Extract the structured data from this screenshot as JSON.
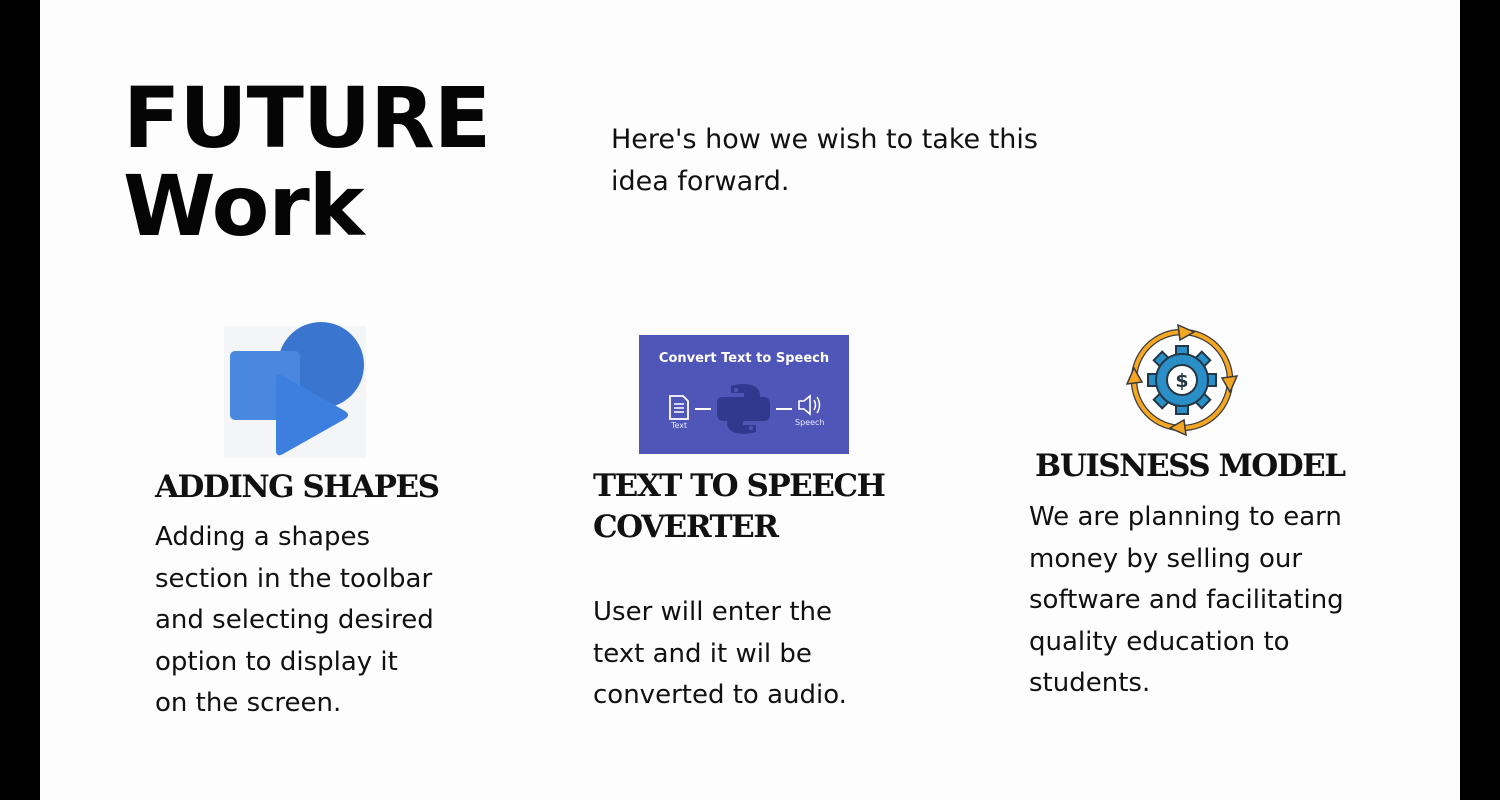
{
  "title": {
    "line1": "FUTURE",
    "line2": "Work"
  },
  "subtitle": {
    "line1": "Here's how we wish to take this",
    "line2": "idea forward."
  },
  "cards": [
    {
      "heading": "ADDING SHAPES",
      "icon": "shapes-icon",
      "body": [
        "Adding a shapes",
        "section in the toolbar",
        "and selecting desired",
        "option to display it",
        "on the screen."
      ]
    },
    {
      "heading_line1": "TEXT TO SPEECH",
      "heading_line2": "COVERTER",
      "icon": "text-to-speech-thumbnail",
      "thumbnail": {
        "title": "Convert Text to Speech",
        "left_label": "Text",
        "right_label": "Speech"
      },
      "body": [
        "User will enter the",
        "text and it wil be",
        "converted to audio."
      ]
    },
    {
      "heading": "BUISNESS MODEL",
      "icon": "money-gear-cycle-icon",
      "body": [
        "We are planning to earn",
        "money by selling our",
        "software and facilitating",
        "quality education to",
        "students."
      ]
    }
  ],
  "colors": {
    "background": "#fdfdfd",
    "frame": "#000000",
    "text": "#111111",
    "shapes_blue": "#3d7fde",
    "tts_purple": "#4f56b7",
    "gear_blue": "#2b8fc7",
    "arrow_orange": "#f5a623"
  }
}
